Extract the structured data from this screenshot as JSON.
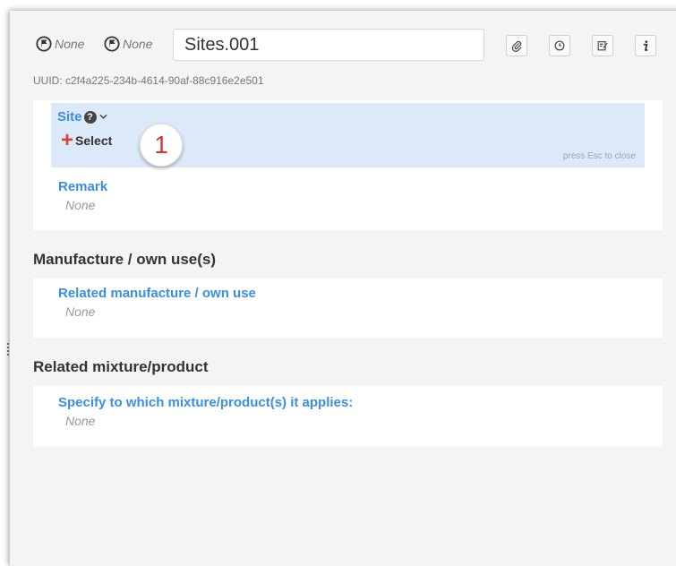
{
  "header": {
    "flag1_label": "None",
    "flag2_label": "None",
    "name_value": "Sites.001",
    "uuid": "UUID: c2f4a225-234b-4614-90af-88c916e2e501"
  },
  "site": {
    "label": "Site",
    "help": "?",
    "select_label": "Select",
    "step_number": "1",
    "esc_hint": "press Esc to close"
  },
  "remark": {
    "label": "Remark",
    "value": "None"
  },
  "manufacture": {
    "title": "Manufacture / own use(s)",
    "field_label": "Related manufacture / own use",
    "value": "None"
  },
  "mixture": {
    "title": "Related mixture/product",
    "field_label": "Specify to which mixture/product(s) it applies:",
    "value": "None"
  },
  "colors": {
    "accent": "#3a8ee6",
    "add": "#e53d2f",
    "highlight": "#dce9f8"
  }
}
